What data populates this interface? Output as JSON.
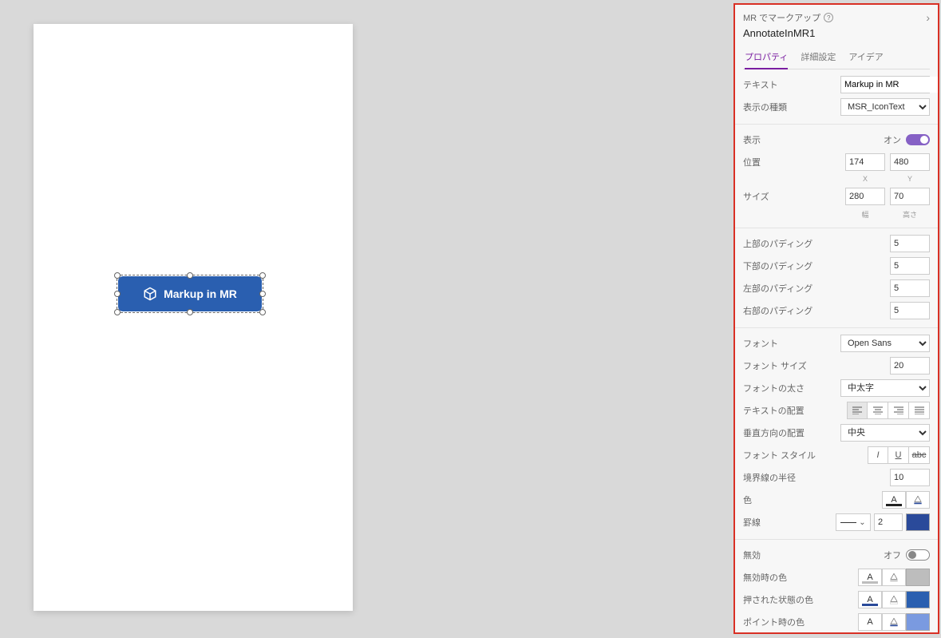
{
  "canvas": {
    "button_label": "Markup in MR"
  },
  "panel": {
    "header_title": "MR でマークアップ",
    "control_name": "AnnotateInMR1",
    "tabs": {
      "properties": "プロパティ",
      "advanced": "詳細設定",
      "ideas": "アイデア"
    }
  },
  "props": {
    "text": {
      "label": "テキスト",
      "value": "Markup in MR"
    },
    "display_type": {
      "label": "表示の種類",
      "value": "MSR_IconText"
    },
    "visible": {
      "label": "表示",
      "state_label": "オン"
    },
    "position": {
      "label": "位置",
      "x": "174",
      "y": "480",
      "x_label": "X",
      "y_label": "Y"
    },
    "size": {
      "label": "サイズ",
      "w": "280",
      "h": "70",
      "w_label": "幅",
      "h_label": "高さ"
    },
    "pad_top": {
      "label": "上部のパディング",
      "value": "5"
    },
    "pad_bottom": {
      "label": "下部のパディング",
      "value": "5"
    },
    "pad_left": {
      "label": "左部のパディング",
      "value": "5"
    },
    "pad_right": {
      "label": "右部のパディング",
      "value": "5"
    },
    "font": {
      "label": "フォント",
      "value": "Open Sans"
    },
    "font_size": {
      "label": "フォント サイズ",
      "value": "20"
    },
    "font_weight": {
      "label": "フォントの太さ",
      "value": "中太字"
    },
    "text_align": {
      "label": "テキストの配置"
    },
    "valign": {
      "label": "垂直方向の配置",
      "value": "中央"
    },
    "font_style": {
      "label": "フォント スタイル"
    },
    "border_radius": {
      "label": "境界線の半径",
      "value": "10"
    },
    "color": {
      "label": "色"
    },
    "border": {
      "label": "罫線",
      "width": "2"
    },
    "disabled": {
      "label": "無効",
      "state_label": "オフ"
    },
    "disabled_color": {
      "label": "無効時の色"
    },
    "pressed_color": {
      "label": "押された状態の色"
    },
    "hover_color": {
      "label": "ポイント時の色"
    }
  }
}
